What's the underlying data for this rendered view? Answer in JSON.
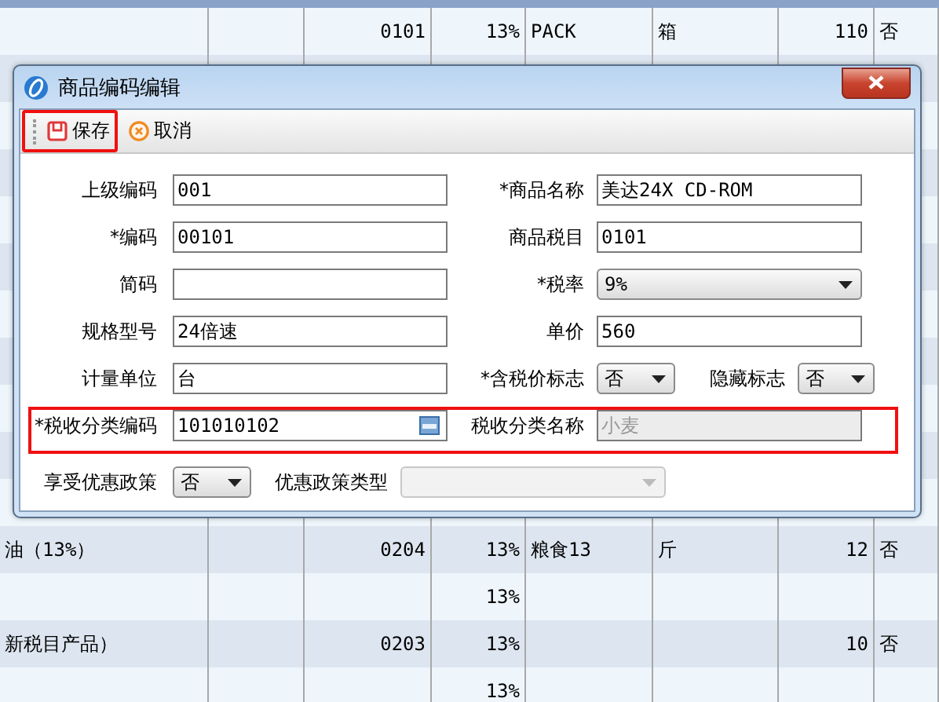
{
  "table": {
    "rows": [
      {
        "code": "0101",
        "rate": "13%",
        "short": "PACK",
        "unit": "箱",
        "price": "110",
        "flag": "否"
      },
      {},
      {},
      {},
      {},
      {},
      {},
      {},
      {},
      {},
      {},
      {
        "name": "油（13%）",
        "code": "0204",
        "rate": "13%",
        "short": "粮食13",
        "unit": "斤",
        "price": "12",
        "flag": "否"
      },
      {
        "rate": "13%"
      },
      {
        "name": "新税目产品）",
        "code": "0203",
        "rate": "13%",
        "price": "10",
        "flag": "否"
      },
      {
        "rate": "13%"
      }
    ]
  },
  "dialog": {
    "title": "商品编码编辑",
    "toolbar": [
      {
        "kind": "save",
        "label": "保存",
        "highlighted": true
      },
      {
        "kind": "cancel",
        "label": "取消",
        "highlighted": false
      }
    ],
    "rows": [
      {
        "highlighted": false,
        "fields": [
          {
            "kind": "text",
            "label": "上级编码",
            "value": "001",
            "disabled": false
          },
          {
            "kind": "text",
            "label": "*商品名称",
            "value": "美达24X CD-ROM",
            "disabled": false
          }
        ]
      },
      {
        "highlighted": false,
        "fields": [
          {
            "kind": "text",
            "label": "*编码",
            "value": "00101",
            "disabled": false
          },
          {
            "kind": "text",
            "label": "商品税目",
            "value": "0101",
            "disabled": false
          }
        ]
      },
      {
        "highlighted": false,
        "fields": [
          {
            "kind": "text",
            "label": "简码",
            "disabled": false
          },
          {
            "kind": "select",
            "label": "*税率",
            "value": "9%",
            "disabled": false
          }
        ]
      },
      {
        "highlighted": false,
        "fields": [
          {
            "kind": "text",
            "label": "规格型号",
            "value": "24倍速",
            "disabled": false
          },
          {
            "kind": "text",
            "label": "单价",
            "value": "560",
            "disabled": false
          }
        ]
      },
      {
        "highlighted": false,
        "fields": [
          {
            "kind": "text",
            "label": "计量单位",
            "value": "台",
            "disabled": false
          },
          {
            "kind": "small-select",
            "label": "*含税价标志",
            "value": "否",
            "disabled": false
          },
          {
            "kind": "small-select",
            "label": "隐藏标志",
            "value": "否",
            "disabled": false
          }
        ]
      },
      {
        "highlighted": true,
        "fields": [
          {
            "kind": "picker",
            "label": "*税收分类编码",
            "value": "101010102",
            "disabled": false
          },
          {
            "kind": "text",
            "label": "税收分类名称",
            "value": "小麦",
            "disabled": true
          }
        ]
      },
      {
        "highlighted": false,
        "fields": [
          {
            "kind": "small-select",
            "label": "享受优惠政策",
            "value": "否",
            "disabled": false
          },
          {
            "kind": "select",
            "label": "优惠政策类型",
            "disabled": true
          }
        ]
      }
    ]
  }
}
